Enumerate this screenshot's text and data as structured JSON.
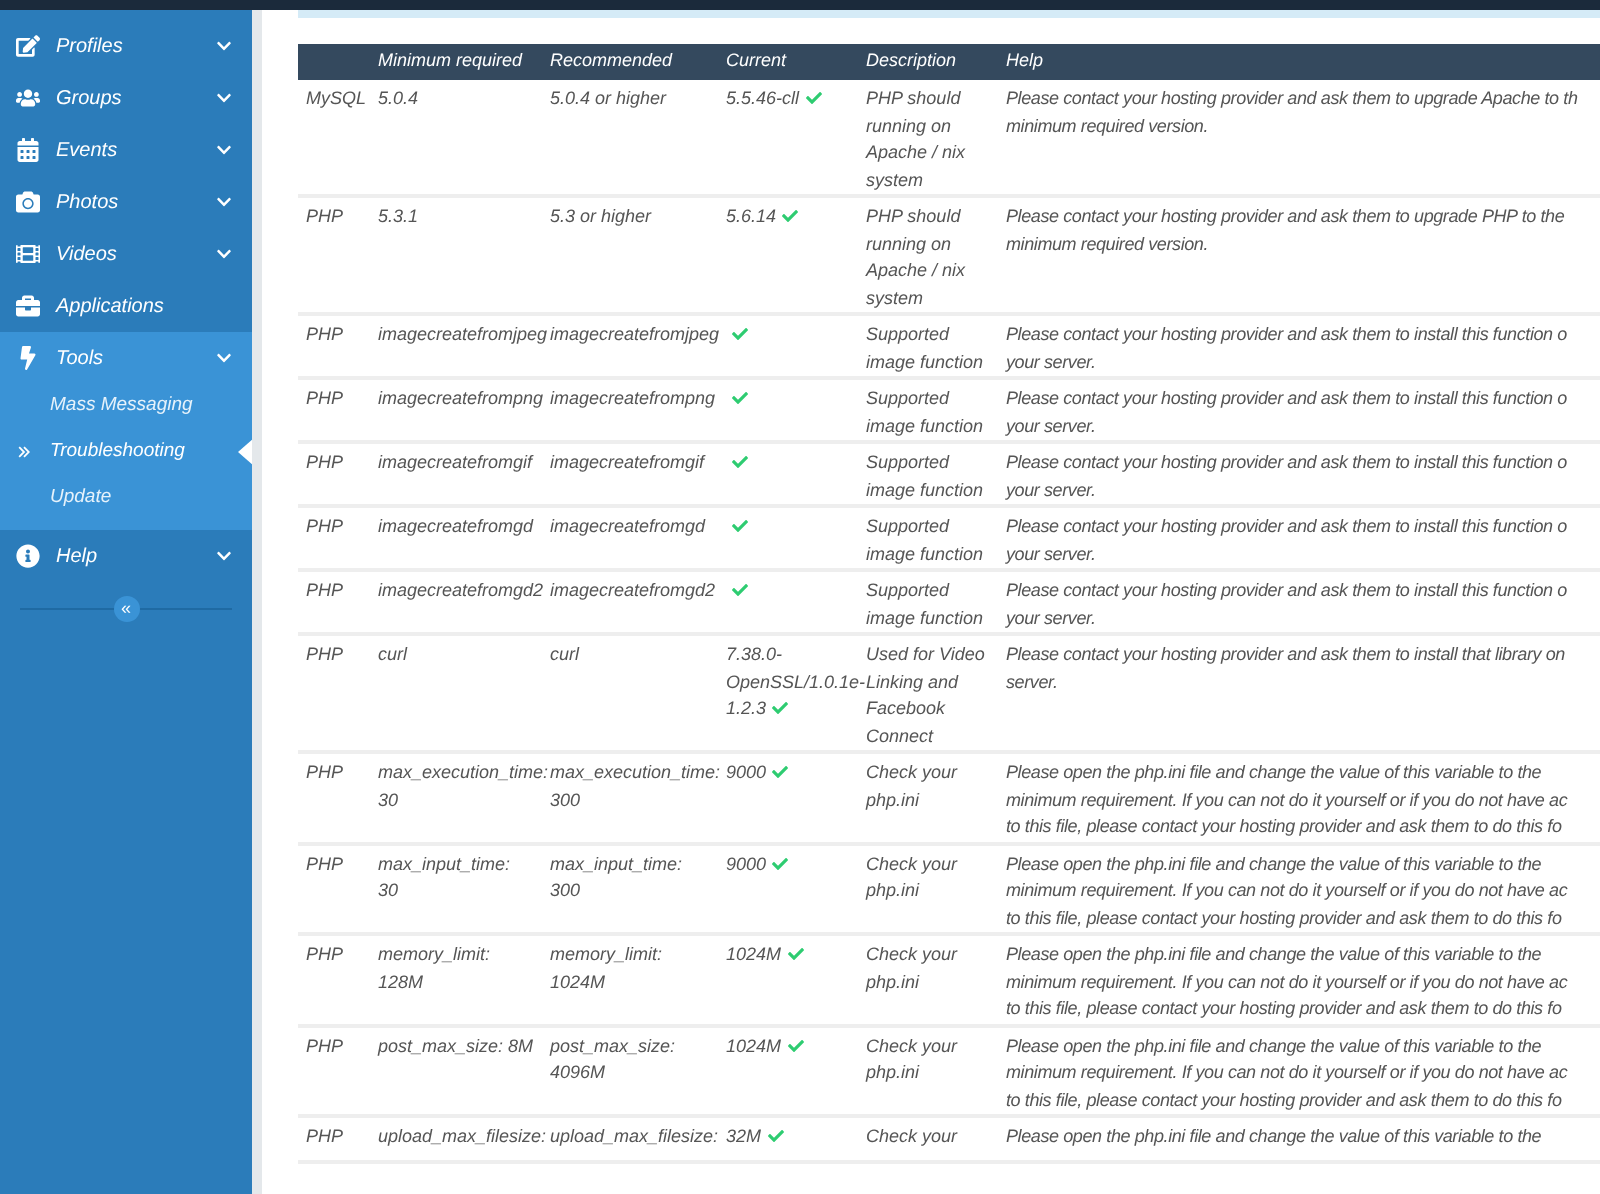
{
  "sidebar": {
    "items": [
      {
        "label": "Profiles",
        "expanded": false
      },
      {
        "label": "Groups",
        "expanded": false
      },
      {
        "label": "Events",
        "expanded": false
      },
      {
        "label": "Photos",
        "expanded": false
      },
      {
        "label": "Videos",
        "expanded": false
      },
      {
        "label": "Applications"
      },
      {
        "label": "Tools",
        "expanded": true,
        "children": [
          {
            "label": "Mass Messaging",
            "selected": false
          },
          {
            "label": "Troubleshooting",
            "selected": true
          },
          {
            "label": "Update",
            "selected": false
          }
        ]
      },
      {
        "label": "Help",
        "expanded": false
      }
    ],
    "collapse_button": "«"
  },
  "table": {
    "columns": [
      "Minimum required",
      "Recommended",
      "Current",
      "Description",
      "Help"
    ],
    "rows": [
      {
        "component": "MySQL",
        "minimum": "5.0.4",
        "recommended": "5.0.4 or higher",
        "current": "5.5.46-cll",
        "passed": true,
        "description": "PHP should running on Apache / nix system",
        "help_lines": [
          "Please contact your hosting provider and ask them to upgrade Apache to th",
          "minimum required version."
        ]
      },
      {
        "component": "PHP",
        "minimum": "5.3.1",
        "recommended": "5.3 or higher",
        "current": "5.6.14",
        "passed": true,
        "description": "PHP should running on Apache / nix system",
        "help_lines": [
          "Please contact your hosting provider and ask them to upgrade PHP to the",
          "minimum required version."
        ]
      },
      {
        "component": "PHP",
        "minimum": "imagecreatefromjpeg",
        "recommended": "imagecreatefromjpeg",
        "passed": true,
        "description": "Supported image function",
        "help_lines": [
          "Please contact your hosting provider and ask them to install this function o",
          "your server."
        ]
      },
      {
        "component": "PHP",
        "minimum": "imagecreatefrompng",
        "recommended": "imagecreatefrompng",
        "passed": true,
        "description": "Supported image function",
        "help_lines": [
          "Please contact your hosting provider and ask them to install this function o",
          "your server."
        ]
      },
      {
        "component": "PHP",
        "minimum": "imagecreatefromgif",
        "recommended": "imagecreatefromgif",
        "passed": true,
        "description": "Supported image function",
        "help_lines": [
          "Please contact your hosting provider and ask them to install this function o",
          "your server."
        ]
      },
      {
        "component": "PHP",
        "minimum": "imagecreatefromgd",
        "recommended": "imagecreatefromgd",
        "passed": true,
        "description": "Supported image function",
        "help_lines": [
          "Please contact your hosting provider and ask them to install this function o",
          "your server."
        ]
      },
      {
        "component": "PHP",
        "minimum": "imagecreatefromgd2",
        "recommended": "imagecreatefromgd2",
        "passed": true,
        "description": "Supported image function",
        "help_lines": [
          "Please contact your hosting provider and ask them to install this function o",
          "your server."
        ]
      },
      {
        "component": "PHP",
        "minimum": "curl",
        "recommended": "curl",
        "current": "7.38.0-OpenSSL/1.0.1e-1.2.3",
        "passed": true,
        "description": "Used for Video Linking and Facebook Connect",
        "help_lines": [
          "Please contact your hosting provider and ask them to install that library on",
          "server."
        ]
      },
      {
        "component": "PHP",
        "minimum": "max_execution_time: 30",
        "recommended": "max_execution_time: 300",
        "current": "9000",
        "passed": true,
        "description": "Check your php.ini",
        "help_lines": [
          "Please open the php.ini file and change the value of this variable to the",
          "minimum requirement. If you can not do it yourself or if you do not have ac",
          "to this file, please contact your hosting provider and ask them to do this fo"
        ]
      },
      {
        "component": "PHP",
        "minimum": "max_input_time: 30",
        "recommended": "max_input_time: 300",
        "current": "9000",
        "passed": true,
        "description": "Check your php.ini",
        "help_lines": [
          "Please open the php.ini file and change the value of this variable to the",
          "minimum requirement. If you can not do it yourself or if you do not have ac",
          "to this file, please contact your hosting provider and ask them to do this fo"
        ]
      },
      {
        "component": "PHP",
        "minimum": "memory_limit: 128M",
        "recommended": "memory_limit: 1024M",
        "current": "1024M",
        "passed": true,
        "description": "Check your php.ini",
        "help_lines": [
          "Please open the php.ini file and change the value of this variable to the",
          "minimum requirement. If you can not do it yourself or if you do not have ac",
          "to this file, please contact your hosting provider and ask them to do this fo"
        ]
      },
      {
        "component": "PHP",
        "minimum": "post_max_size: 8M",
        "recommended": "post_max_size: 4096M",
        "current": "1024M",
        "passed": true,
        "description": "Check your php.ini",
        "help_lines": [
          "Please open the php.ini file and change the value of this variable to the",
          "minimum requirement. If you can not do it yourself or if you do not have ac",
          "to this file, please contact your hosting provider and ask them to do this fo"
        ]
      },
      {
        "component": "PHP",
        "minimum": "upload_max_filesize:",
        "recommended": "upload_max_filesize:",
        "current": "32M",
        "passed": true,
        "description": "Check your",
        "help_lines": [
          "Please open the php.ini file and change the value of this variable to the"
        ]
      }
    ]
  }
}
